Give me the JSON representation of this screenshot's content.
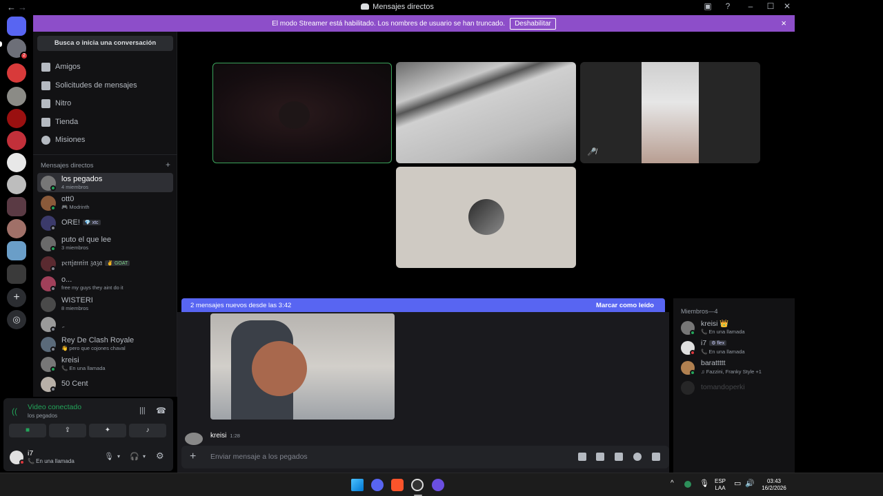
{
  "window": {
    "title": "Mensajes directos",
    "back": "←",
    "forward": "→"
  },
  "banner": {
    "text": "El modo Streamer está habilitado. Los nombres de usuario se han truncado.",
    "button": "Deshabilitar",
    "close": "×"
  },
  "rail": {
    "badge_count": "2"
  },
  "sidebar": {
    "search_label": "Busca o inicia una conversación",
    "nav": [
      {
        "label": "Amigos",
        "icon": "friends-icon"
      },
      {
        "label": "Solicitudes de mensajes",
        "icon": "mail-icon"
      },
      {
        "label": "Nitro",
        "icon": "nitro-icon"
      },
      {
        "label": "Tienda",
        "icon": "shop-icon"
      },
      {
        "label": "Misiones",
        "icon": "quests-icon"
      }
    ],
    "dm_header": "Mensajes directos",
    "dm_add": "+",
    "dms": [
      {
        "name": "los pegados",
        "sub": "4 miembros"
      },
      {
        "name": "ott0",
        "sub": "🎮 Modrinth"
      },
      {
        "name": "ORE!",
        "tag": "💎 xtc",
        "sub": ""
      },
      {
        "name": "puto el que lee",
        "sub": "3 miembros"
      },
      {
        "name": "𝔭𝔢𝔫𝔧𝔞𝔪𝔦𝔫 𝔷𝔞𝔷𝔞",
        "tag": "✌ GOAT",
        "sub": ""
      },
      {
        "name": "o...",
        "sub": "free my guys they aint do it"
      },
      {
        "name": "WISTERI",
        "sub": "8 miembros"
      },
      {
        "name": "ِ",
        "sub": ""
      },
      {
        "name": "Rey De Clash Royale",
        "sub": "👋 pero que cojones chaval"
      },
      {
        "name": "kreisi",
        "sub": "📞 En una llamada"
      },
      {
        "name": "50 Cent",
        "sub": ""
      }
    ]
  },
  "voice": {
    "status": "Video conectado",
    "channel": "los pegados"
  },
  "user": {
    "name": "i7",
    "status": "📞 En una llamada"
  },
  "chat": {
    "new_messages": "2 mensajes nuevos desde las 3:42",
    "mark_read": "Marcar como leído",
    "author": "kreisi",
    "time": "1:28",
    "placeholder": "Enviar mensaje a los pegados"
  },
  "members": {
    "header": "Miembros—4",
    "list": [
      {
        "name": "kreisi 👑",
        "sub": "📞 En una llamada"
      },
      {
        "name": "i7",
        "tag": "⚙ flex",
        "sub": "📞 En una llamada"
      },
      {
        "name": "barattttt",
        "sub": "♫ Fazzini, Franky Style +1"
      },
      {
        "name": "tomandoperki",
        "sub": ""
      }
    ]
  },
  "taskbar": {
    "lang1": "ESP",
    "lang2": "LAA",
    "time": "03:43",
    "date": "16/2/2026"
  }
}
